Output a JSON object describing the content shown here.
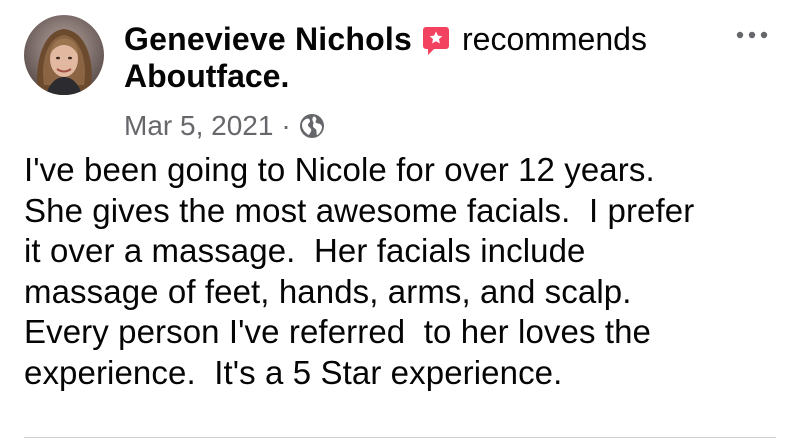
{
  "post": {
    "author_name": "Genevieve Nichols",
    "action_text": "recommends",
    "page_name": "Aboutface.",
    "date": "Mar 5, 2021",
    "meta_separator": "·",
    "body_lines": [
      "I've been going to Nicole for over 12 years.",
      "She gives the most awesome facials.  I prefer",
      "it over a massage.  Her facials include",
      "massage of feet, hands, arms, and scalp.",
      "Every person I've referred  to her loves the",
      "experience.  It's a 5 Star experience."
    ]
  },
  "icons": {
    "more": "more-horizontal-icon",
    "recommend": "recommend-star-icon",
    "privacy": "globe-icon"
  },
  "colors": {
    "text_primary": "#050505",
    "text_secondary": "#65676b",
    "recommend_badge": "#f3425f",
    "divider": "#ced0d4"
  }
}
